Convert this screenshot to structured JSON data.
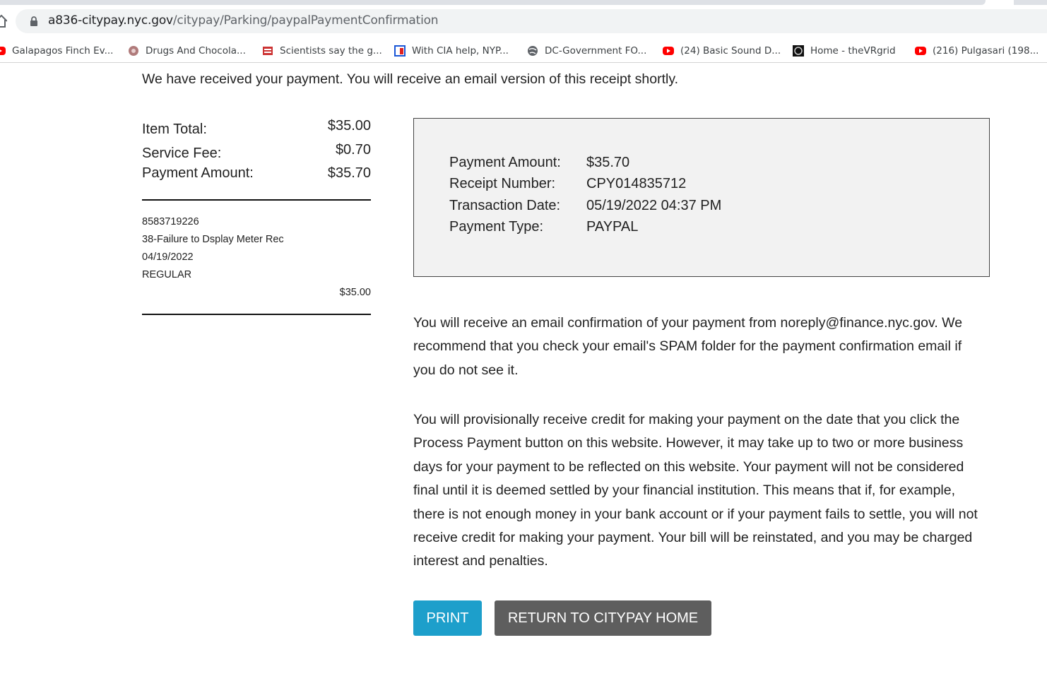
{
  "browser": {
    "url_host": "a836-citypay.nyc.gov",
    "url_path": "/citypay/Parking/paypalPaymentConfirmation",
    "bookmarks": [
      {
        "label": "Galapagos Finch Ev...",
        "icon": "youtube-icon"
      },
      {
        "label": "Drugs And Chocola...",
        "icon": "site-icon"
      },
      {
        "label": "Scientists say the g...",
        "icon": "site-icon"
      },
      {
        "label": "With CIA help, NYP...",
        "icon": "site-icon"
      },
      {
        "label": "DC-Government FO...",
        "icon": "globe-icon"
      },
      {
        "label": "(24) Basic Sound D...",
        "icon": "youtube-icon"
      },
      {
        "label": "Home - theVRgrid",
        "icon": "site-icon"
      },
      {
        "label": "(216) Pulgasari (198...",
        "icon": "youtube-icon"
      }
    ]
  },
  "intro": "We have received your payment. You will receive an email version of this receipt shortly.",
  "summary": {
    "item_total_label": "Item Total:",
    "item_total_value": "$35.00",
    "service_fee_label": "Service Fee:",
    "service_fee_value": "$0.70",
    "payment_amount_label": "Payment Amount:",
    "payment_amount_value": "$35.70"
  },
  "violation": {
    "number": "8583719226",
    "description": "38-Failure to Dsplay Meter Rec",
    "date": "04/19/2022",
    "type": "REGULAR",
    "amount": "$35.00"
  },
  "receipt": {
    "payment_amount_label": "Payment Amount:",
    "payment_amount_value": "$35.70",
    "receipt_number_label": "Receipt Number:",
    "receipt_number_value": "CPY014835712",
    "transaction_date_label": "Transaction Date:",
    "transaction_date_value": "05/19/2022 04:37 PM",
    "payment_type_label": "Payment Type:",
    "payment_type_value": "PAYPAL"
  },
  "notice_email": "You will receive an email confirmation of your payment from noreply@finance.nyc.gov. We recommend that you check your email's SPAM folder for the payment confirmation email if you do not see it.",
  "notice_credit": "You will provisionally receive credit for making your payment on the date that you click the Process Payment button on this website. However, it may take up to two or more business days for your payment to be reflected on this website. Your payment will not be considered final until it is deemed settled by your financial institution. This means that if, for example, there is not enough money in your bank account or if your payment fails to settle, you will not receive credit for making your payment. Your bill will be reinstated, and you may be charged interest and penalties.",
  "buttons": {
    "print": "PRINT",
    "return_home": "RETURN TO CITYPAY HOME"
  },
  "colors": {
    "print_button": "#1d9fcb",
    "home_button": "#5e5e5e",
    "receipt_box_bg": "#f2f2f2"
  }
}
